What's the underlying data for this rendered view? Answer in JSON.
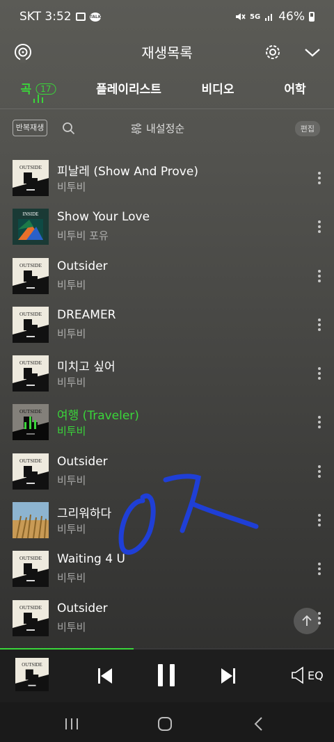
{
  "status": {
    "carrier_time": "SKT 3:52",
    "network": "5G",
    "battery": "46%"
  },
  "header": {
    "title": "재생목록"
  },
  "tabs": [
    {
      "label": "곡",
      "badge": "17",
      "active": true
    },
    {
      "label": "플레이리스트"
    },
    {
      "label": "비디오"
    },
    {
      "label": "어학"
    }
  ],
  "toolbar": {
    "repeat_label": "반복재생",
    "sort_label": "내설정순",
    "edit_label": "편집"
  },
  "tracks": [
    {
      "title": "피날레 (Show And Prove)",
      "artist": "비투비",
      "art": "outside"
    },
    {
      "title": "Show Your Love",
      "artist": "비투비 포유",
      "art": "inside"
    },
    {
      "title": "Outsider",
      "artist": "비투비",
      "art": "outside"
    },
    {
      "title": "DREAMER",
      "artist": "비투비",
      "art": "outside"
    },
    {
      "title": "미치고 싶어",
      "artist": "비투비",
      "art": "outside"
    },
    {
      "title": "여행 (Traveler)",
      "artist": "비투비",
      "art": "outside",
      "playing": true
    },
    {
      "title": "Outsider",
      "artist": "비투비",
      "art": "outside"
    },
    {
      "title": "그리워하다",
      "artist": "비투비",
      "art": "field"
    },
    {
      "title": "Waiting 4 U",
      "artist": "비투비",
      "art": "outside"
    },
    {
      "title": "Outsider",
      "artist": "비투비",
      "art": "outside"
    }
  ],
  "art_text": {
    "outside": "OUTSIDE",
    "inside": "INSIDE"
  },
  "player": {
    "progress": 0.4,
    "eq_label": "EQ"
  },
  "colors": {
    "accent": "#3ad63a",
    "handwriting": "#1f3fd6"
  }
}
